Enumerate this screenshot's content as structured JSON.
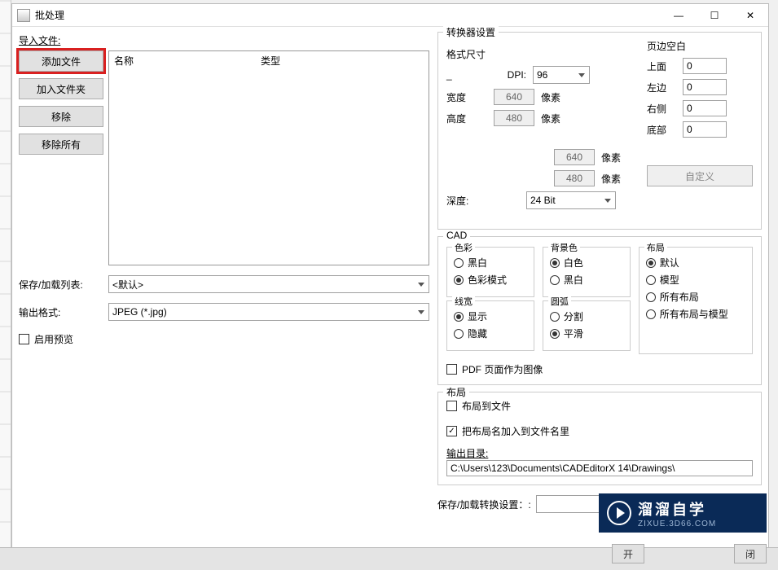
{
  "window": {
    "title": "批处理",
    "min": "—",
    "max": "☐",
    "close": "✕"
  },
  "left": {
    "import_label": "导入文件:",
    "buttons": {
      "add_file": "添加文件",
      "add_folder": "加入文件夹",
      "remove": "移除",
      "remove_all": "移除所有"
    },
    "list": {
      "col_name": "名称",
      "col_type": "类型"
    },
    "save_list_label": "保存/加载列表:",
    "save_list_value": "<默认>",
    "output_format_label": "输出格式:",
    "output_format_value": "JPEG (*.jpg)",
    "enable_preview": "启用预览"
  },
  "converter": {
    "legend": "转换器设置",
    "format_size": {
      "legend": "格式尺寸",
      "dash": "_",
      "dpi_label": "DPI:",
      "dpi_value": "96",
      "width_label": "宽度",
      "width_value": "640",
      "width_unit": "像素",
      "height_label": "高度",
      "height_value": "480",
      "height_unit": "像素",
      "extra_w": "640",
      "extra_w_unit": "像素",
      "extra_h": "480",
      "extra_h_unit": "像素",
      "depth_label": "深度:",
      "depth_value": "24 Bit"
    },
    "margins": {
      "legend": "页边空白",
      "top_label": "上面",
      "top_value": "0",
      "left_label": "左边",
      "left_value": "0",
      "right_label": "右侧",
      "right_value": "0",
      "bottom_label": "底部",
      "bottom_value": "0",
      "custom_btn": "自定义"
    },
    "cad": {
      "legend": "CAD",
      "color": {
        "legend": "色彩",
        "opt1": "黑白",
        "opt2": "色彩模式",
        "selected": "opt2"
      },
      "bg": {
        "legend": "背景色",
        "opt1": "白色",
        "opt2": "黑白",
        "selected": "opt1"
      },
      "layout": {
        "legend": "布局",
        "opt1": "默认",
        "opt2": "模型",
        "opt3": "所有布局",
        "opt4": "所有布局与模型",
        "selected": "opt1"
      },
      "lineweight": {
        "legend": "线宽",
        "opt1": "显示",
        "opt2": "隐藏",
        "selected": "opt1"
      },
      "arc": {
        "legend": "圆弧",
        "opt1": "分割",
        "opt2": "平滑",
        "selected": "opt2"
      },
      "pdf_as_image": "PDF 页面作为图像"
    },
    "layout_out": {
      "legend": "布局",
      "layouts_to_files": "布局到文件",
      "append_layout_name": "把布局名加入到文件名里",
      "out_dir_label": "输出目录:",
      "out_dir_value": "C:\\Users\\123\\Documents\\CADEditorX 14\\Drawings\\"
    },
    "save_conv_label": "保存/加载转换设置：:"
  },
  "bottom": {
    "open": "开",
    "close": "闭"
  },
  "watermark": {
    "line1": "溜溜自学",
    "line2": "ZIXUE.3D66.COM"
  }
}
